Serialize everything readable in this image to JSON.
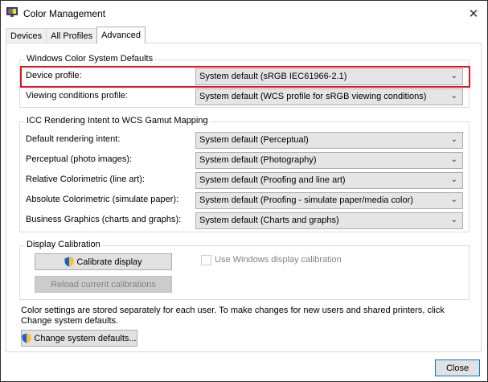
{
  "window": {
    "title": "Color Management",
    "close_glyph": "✕"
  },
  "tabs": [
    {
      "label": "Devices"
    },
    {
      "label": "All Profiles"
    },
    {
      "label": "Advanced"
    }
  ],
  "wcs_defaults": {
    "title": "Windows Color System Defaults",
    "device_profile": {
      "label": "Device profile:",
      "value": "System default (sRGB IEC61966-2.1)"
    },
    "viewing_conditions": {
      "label": "Viewing conditions profile:",
      "value": "System default (WCS profile for sRGB viewing conditions)"
    }
  },
  "icc_mapping": {
    "title": "ICC Rendering Intent to WCS Gamut Mapping",
    "rows": [
      {
        "label": "Default rendering intent:",
        "value": "System default (Perceptual)"
      },
      {
        "label": "Perceptual (photo images):",
        "value": "System default (Photography)"
      },
      {
        "label": "Relative Colorimetric (line art):",
        "value": "System default (Proofing and line art)"
      },
      {
        "label": "Absolute Colorimetric (simulate paper):",
        "value": "System default (Proofing - simulate paper/media color)"
      },
      {
        "label": "Business Graphics (charts and graphs):",
        "value": "System default (Charts and graphs)"
      }
    ]
  },
  "calibration": {
    "title": "Display Calibration",
    "calibrate_button": "Calibrate display",
    "reload_button": "Reload current calibrations",
    "checkbox_label": "Use Windows display calibration",
    "checkbox_checked": false
  },
  "footer": {
    "note": "Color settings are stored separately for each user. To make changes for new users and shared printers, click Change system defaults.",
    "change_defaults_button": "Change system defaults...",
    "close_button": "Close"
  },
  "colors": {
    "highlight": "#e0141e",
    "focus_border": "#0078d7"
  },
  "icons": [
    "color-management-app-icon",
    "shield-icon",
    "chevron-down-icon",
    "close-icon"
  ]
}
